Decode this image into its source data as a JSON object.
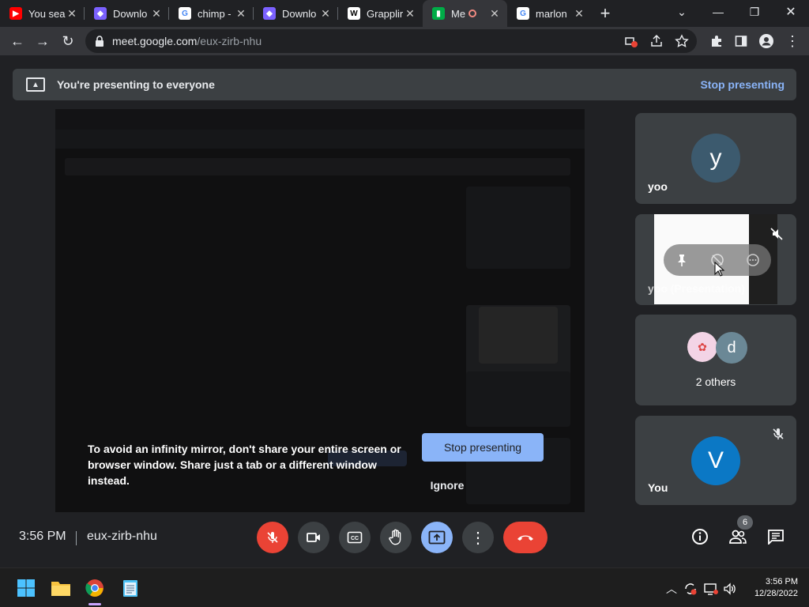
{
  "browser": {
    "tabs": [
      {
        "title": "You sear",
        "favicon": "youtube-icon",
        "color": "#ff0000",
        "active": false
      },
      {
        "title": "Downlo",
        "favicon": "download-app-icon",
        "color": "#7b61ff",
        "active": false
      },
      {
        "title": "chimp -",
        "favicon": "google-icon",
        "color": "#4285f4",
        "active": false
      },
      {
        "title": "Downlo",
        "favicon": "download-app-icon",
        "color": "#7b61ff",
        "active": false
      },
      {
        "title": "Grapplir",
        "favicon": "wikipedia-icon",
        "color": "#ffffff",
        "active": false
      },
      {
        "title": "Me",
        "favicon": "google-meet-icon",
        "color": "#00ac47",
        "active": true,
        "recording": true
      },
      {
        "title": "marlon",
        "favicon": "google-icon",
        "color": "#4285f4",
        "active": false
      }
    ],
    "url_host": "meet.google.com",
    "url_path": "/eux-zirb-nhu"
  },
  "meet": {
    "banner_text": "You're presenting to everyone",
    "banner_stop": "Stop presenting",
    "warning_text": "To avoid an infinity mirror, don't share your entire screen or browser window. Share just a tab or a different window instead.",
    "stop_button": "Stop presenting",
    "ignore_button": "Ignore",
    "participants": [
      {
        "name": "yoo",
        "initial": "y",
        "avatar_color": "#3c5a6e"
      },
      {
        "name": "yoo (Presentation)"
      },
      {
        "name": "2 others",
        "initial": "d",
        "avatar_color": "#6b8896"
      },
      {
        "name": "You",
        "initial": "V",
        "avatar_color": "#0b78c5"
      }
    ],
    "time": "3:56 PM",
    "meeting_code": "eux-zirb-nhu",
    "participant_count": "6"
  },
  "taskbar": {
    "time": "3:56 PM",
    "date": "12/28/2022"
  },
  "colors": {
    "accent": "#8ab4f8",
    "danger": "#ea4335",
    "tile": "#3c4043"
  }
}
